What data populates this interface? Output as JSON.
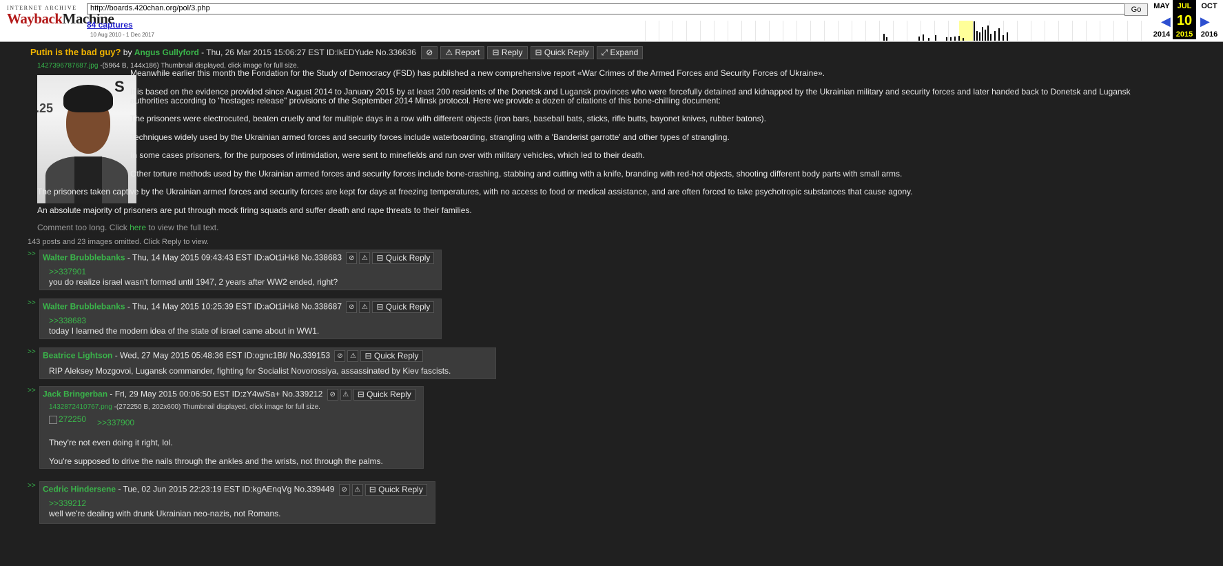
{
  "wayback": {
    "logo_top": "INTERNET ARCHIVE",
    "logo_wayback": "Wayback",
    "logo_machine": "Machine",
    "url": "http://boards.420chan.org/pol/3.php",
    "go": "Go",
    "captures": "84 captures",
    "range": "10 Aug 2010 - 1 Dec 2017",
    "cal_prev": {
      "month": "MAY",
      "year": "2014"
    },
    "cal_cur": {
      "month": "JUL",
      "day": "10",
      "year": "2015"
    },
    "cal_next": {
      "month": "OCT",
      "year": "2016"
    }
  },
  "op": {
    "subject": "Putin is the bad guy?",
    "by": "by",
    "name": "Angus Gullyford",
    "meta": " - Thu, 26 Mar 2015 15:06:27 EST ID:lkEDYude No.336636",
    "report": "Report",
    "reply": "Reply",
    "quick_reply": "Quick Reply",
    "expand": "Expand",
    "file_name": "1427396787687.jpg",
    "file_info": " -(5964 B, 144x186) Thumbnail displayed, click image for full size.",
    "paragraphs": [
      "Meanwhile earlier this month the Fondation for the Study of Democracy (FSD) has published a new comprehensive report «War Crimes of the Armed Forces and Security Forces of Ukraine».",
      "It is based on the evidence provided since August 2014 to January 2015 by at least 200 residents of the Donetsk and Lugansk provinces who were forcefully detained and kidnapped by the Ukrainian military and security forces and later handed back to Donetsk and Lugansk",
      "authorities according to \"hostages release\" provisions of the September 2014 Minsk protocol. Here we provide a dozen of citations of this bone-chilling document:",
      "The prisoners were electrocuted, beaten cruelly and for multiple days in a row with different objects (iron bars, baseball bats, sticks, rifle butts, bayonet knives, rubber batons).",
      "Techniques widely used by the Ukrainian armed forces and security forces include waterboarding, strangling with a 'Banderist garrotte' and other types of strangling.",
      "In some cases prisoners, for the purposes of intimidation, were sent to minefields and run over with military vehicles, which led to their death.",
      "Other torture methods used by the Ukrainian armed forces and security forces include bone-crashing, stabbing and cutting with a knife, branding with red-hot objects, shooting different body parts with small arms.",
      "The prisoners taken captive by the Ukrainian armed forces and security forces are kept for days at freezing temperatures, with no access to food or medical assistance, and are often forced to take psychotropic substances that cause agony.",
      "An absolute majority of prisoners are put through mock firing squads and suffer death and rape threats to their families."
    ],
    "too_long_pre": "Comment too long. Click ",
    "too_long_link": "here",
    "too_long_post": " to view the full text."
  },
  "omitted": "143 posts and 23 images omitted. Click Reply to view.",
  "reply_arrow": ">>",
  "quick_reply_label": "Quick Reply",
  "replies": [
    {
      "name": "Walter Brubblebanks",
      "meta": " - Thu, 14 May 2015 09:43:43 EST ID:aOt1iHk8 No.338683",
      "quote": ">>337901",
      "lines": [
        "you do realize israel wasn't formed until 1947, 2 years after WW2 ended, right?"
      ]
    },
    {
      "name": "Walter Brubblebanks",
      "meta": " - Thu, 14 May 2015 10:25:39 EST ID:aOt1iHk8 No.338687",
      "quote": ">>338683",
      "lines": [
        "today I learned the modern idea of the state of israel came about in WW1."
      ]
    },
    {
      "name": "Beatrice Lightson",
      "meta": " - Wed, 27 May 2015 05:48:36 EST ID:ognc1Bf/ No.339153",
      "lines": [
        "RIP Aleksey Mozgovoi, Lugansk commander, fighting for Socialist Novorossiya, assassinated by Kiev fascists."
      ]
    },
    {
      "name": "Jack Bringerban",
      "meta": " - Fri, 29 May 2015 00:06:50 EST ID:zY4w/Sa+ No.339212",
      "file_name": "1432872410767.png",
      "file_info": " -(272250 B, 202x600) Thumbnail displayed, click image for full size.",
      "img_alt": "272250",
      "quote": ">>337900",
      "lines": [
        "They're not even doing it right, lol.",
        "You're supposed to drive the nails through the ankles and the wrists, not through the palms."
      ]
    },
    {
      "name": "Cedric Hindersene",
      "meta": " - Tue, 02 Jun 2015 22:23:19 EST ID:kgAEnqVg No.339449",
      "quote": ">>339212",
      "lines": [
        "well we're dealing with drunk Ukrainian neo-nazis, not Romans."
      ]
    }
  ]
}
